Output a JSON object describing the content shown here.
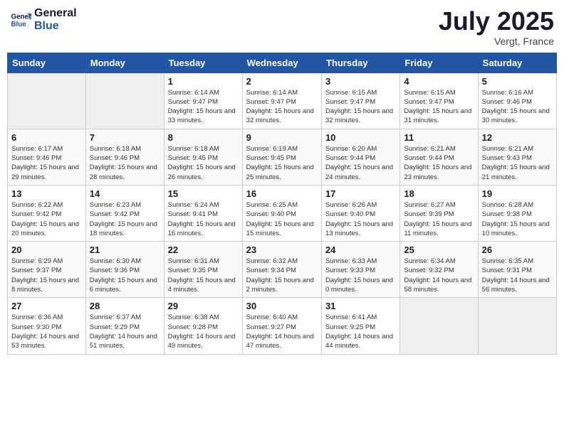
{
  "header": {
    "logo_line1": "General",
    "logo_line2": "Blue",
    "month": "July 2025",
    "location": "Vergt, France"
  },
  "columns": [
    "Sunday",
    "Monday",
    "Tuesday",
    "Wednesday",
    "Thursday",
    "Friday",
    "Saturday"
  ],
  "rows": [
    [
      {
        "empty": true
      },
      {
        "empty": true
      },
      {
        "day": "1",
        "sunrise": "6:14 AM",
        "sunset": "9:47 PM",
        "daylight": "15 hours and 33 minutes."
      },
      {
        "day": "2",
        "sunrise": "6:14 AM",
        "sunset": "9:47 PM",
        "daylight": "15 hours and 32 minutes."
      },
      {
        "day": "3",
        "sunrise": "6:15 AM",
        "sunset": "9:47 PM",
        "daylight": "15 hours and 32 minutes."
      },
      {
        "day": "4",
        "sunrise": "6:15 AM",
        "sunset": "9:47 PM",
        "daylight": "15 hours and 31 minutes."
      },
      {
        "day": "5",
        "sunrise": "6:16 AM",
        "sunset": "9:46 PM",
        "daylight": "15 hours and 30 minutes."
      }
    ],
    [
      {
        "day": "6",
        "sunrise": "6:17 AM",
        "sunset": "9:46 PM",
        "daylight": "15 hours and 29 minutes."
      },
      {
        "day": "7",
        "sunrise": "6:18 AM",
        "sunset": "9:46 PM",
        "daylight": "15 hours and 28 minutes."
      },
      {
        "day": "8",
        "sunrise": "6:18 AM",
        "sunset": "9:45 PM",
        "daylight": "15 hours and 26 minutes."
      },
      {
        "day": "9",
        "sunrise": "6:19 AM",
        "sunset": "9:45 PM",
        "daylight": "15 hours and 25 minutes."
      },
      {
        "day": "10",
        "sunrise": "6:20 AM",
        "sunset": "9:44 PM",
        "daylight": "15 hours and 24 minutes."
      },
      {
        "day": "11",
        "sunrise": "6:21 AM",
        "sunset": "9:44 PM",
        "daylight": "15 hours and 23 minutes."
      },
      {
        "day": "12",
        "sunrise": "6:21 AM",
        "sunset": "9:43 PM",
        "daylight": "15 hours and 21 minutes."
      }
    ],
    [
      {
        "day": "13",
        "sunrise": "6:22 AM",
        "sunset": "9:42 PM",
        "daylight": "15 hours and 20 minutes."
      },
      {
        "day": "14",
        "sunrise": "6:23 AM",
        "sunset": "9:42 PM",
        "daylight": "15 hours and 18 minutes."
      },
      {
        "day": "15",
        "sunrise": "6:24 AM",
        "sunset": "9:41 PM",
        "daylight": "15 hours and 16 minutes."
      },
      {
        "day": "16",
        "sunrise": "6:25 AM",
        "sunset": "9:40 PM",
        "daylight": "15 hours and 15 minutes."
      },
      {
        "day": "17",
        "sunrise": "6:26 AM",
        "sunset": "9:40 PM",
        "daylight": "15 hours and 13 minutes."
      },
      {
        "day": "18",
        "sunrise": "6:27 AM",
        "sunset": "9:39 PM",
        "daylight": "15 hours and 11 minutes."
      },
      {
        "day": "19",
        "sunrise": "6:28 AM",
        "sunset": "9:38 PM",
        "daylight": "15 hours and 10 minutes."
      }
    ],
    [
      {
        "day": "20",
        "sunrise": "6:29 AM",
        "sunset": "9:37 PM",
        "daylight": "15 hours and 8 minutes."
      },
      {
        "day": "21",
        "sunrise": "6:30 AM",
        "sunset": "9:36 PM",
        "daylight": "15 hours and 6 minutes."
      },
      {
        "day": "22",
        "sunrise": "6:31 AM",
        "sunset": "9:35 PM",
        "daylight": "15 hours and 4 minutes."
      },
      {
        "day": "23",
        "sunrise": "6:32 AM",
        "sunset": "9:34 PM",
        "daylight": "15 hours and 2 minutes."
      },
      {
        "day": "24",
        "sunrise": "6:33 AM",
        "sunset": "9:33 PM",
        "daylight": "15 hours and 0 minutes."
      },
      {
        "day": "25",
        "sunrise": "6:34 AM",
        "sunset": "9:32 PM",
        "daylight": "14 hours and 58 minutes."
      },
      {
        "day": "26",
        "sunrise": "6:35 AM",
        "sunset": "9:31 PM",
        "daylight": "14 hours and 56 minutes."
      }
    ],
    [
      {
        "day": "27",
        "sunrise": "6:36 AM",
        "sunset": "9:30 PM",
        "daylight": "14 hours and 53 minutes."
      },
      {
        "day": "28",
        "sunrise": "6:37 AM",
        "sunset": "9:29 PM",
        "daylight": "14 hours and 51 minutes."
      },
      {
        "day": "29",
        "sunrise": "6:38 AM",
        "sunset": "9:28 PM",
        "daylight": "14 hours and 49 minutes."
      },
      {
        "day": "30",
        "sunrise": "6:40 AM",
        "sunset": "9:27 PM",
        "daylight": "14 hours and 47 minutes."
      },
      {
        "day": "31",
        "sunrise": "6:41 AM",
        "sunset": "9:25 PM",
        "daylight": "14 hours and 44 minutes."
      },
      {
        "empty": true
      },
      {
        "empty": true
      }
    ]
  ],
  "labels": {
    "sunrise": "Sunrise:",
    "sunset": "Sunset:",
    "daylight": "Daylight:"
  }
}
